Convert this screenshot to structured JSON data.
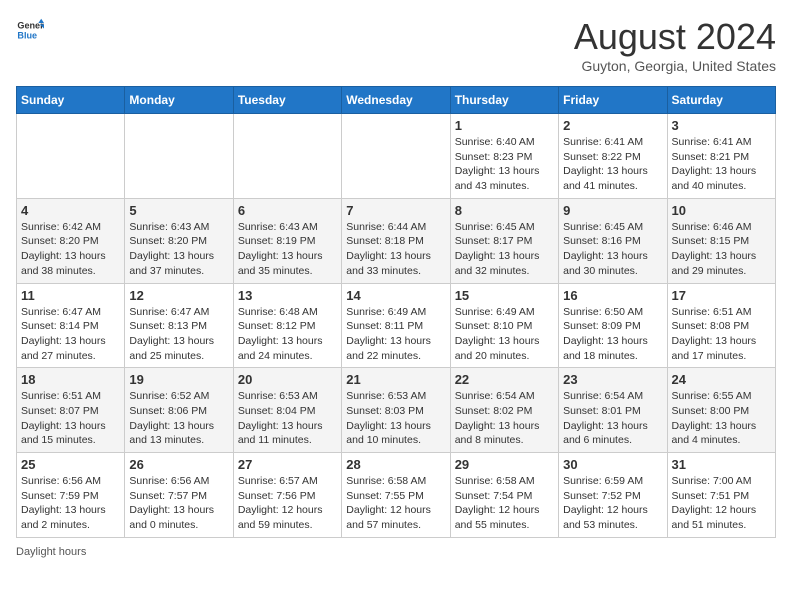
{
  "header": {
    "logo_general": "General",
    "logo_blue": "Blue",
    "month_title": "August 2024",
    "subtitle": "Guyton, Georgia, United States"
  },
  "days_of_week": [
    "Sunday",
    "Monday",
    "Tuesday",
    "Wednesday",
    "Thursday",
    "Friday",
    "Saturday"
  ],
  "weeks": [
    [
      {
        "day": "",
        "sunrise": "",
        "sunset": "",
        "daylight": ""
      },
      {
        "day": "",
        "sunrise": "",
        "sunset": "",
        "daylight": ""
      },
      {
        "day": "",
        "sunrise": "",
        "sunset": "",
        "daylight": ""
      },
      {
        "day": "",
        "sunrise": "",
        "sunset": "",
        "daylight": ""
      },
      {
        "day": "1",
        "sunrise": "Sunrise: 6:40 AM",
        "sunset": "Sunset: 8:23 PM",
        "daylight": "Daylight: 13 hours and 43 minutes."
      },
      {
        "day": "2",
        "sunrise": "Sunrise: 6:41 AM",
        "sunset": "Sunset: 8:22 PM",
        "daylight": "Daylight: 13 hours and 41 minutes."
      },
      {
        "day": "3",
        "sunrise": "Sunrise: 6:41 AM",
        "sunset": "Sunset: 8:21 PM",
        "daylight": "Daylight: 13 hours and 40 minutes."
      }
    ],
    [
      {
        "day": "4",
        "sunrise": "Sunrise: 6:42 AM",
        "sunset": "Sunset: 8:20 PM",
        "daylight": "Daylight: 13 hours and 38 minutes."
      },
      {
        "day": "5",
        "sunrise": "Sunrise: 6:43 AM",
        "sunset": "Sunset: 8:20 PM",
        "daylight": "Daylight: 13 hours and 37 minutes."
      },
      {
        "day": "6",
        "sunrise": "Sunrise: 6:43 AM",
        "sunset": "Sunset: 8:19 PM",
        "daylight": "Daylight: 13 hours and 35 minutes."
      },
      {
        "day": "7",
        "sunrise": "Sunrise: 6:44 AM",
        "sunset": "Sunset: 8:18 PM",
        "daylight": "Daylight: 13 hours and 33 minutes."
      },
      {
        "day": "8",
        "sunrise": "Sunrise: 6:45 AM",
        "sunset": "Sunset: 8:17 PM",
        "daylight": "Daylight: 13 hours and 32 minutes."
      },
      {
        "day": "9",
        "sunrise": "Sunrise: 6:45 AM",
        "sunset": "Sunset: 8:16 PM",
        "daylight": "Daylight: 13 hours and 30 minutes."
      },
      {
        "day": "10",
        "sunrise": "Sunrise: 6:46 AM",
        "sunset": "Sunset: 8:15 PM",
        "daylight": "Daylight: 13 hours and 29 minutes."
      }
    ],
    [
      {
        "day": "11",
        "sunrise": "Sunrise: 6:47 AM",
        "sunset": "Sunset: 8:14 PM",
        "daylight": "Daylight: 13 hours and 27 minutes."
      },
      {
        "day": "12",
        "sunrise": "Sunrise: 6:47 AM",
        "sunset": "Sunset: 8:13 PM",
        "daylight": "Daylight: 13 hours and 25 minutes."
      },
      {
        "day": "13",
        "sunrise": "Sunrise: 6:48 AM",
        "sunset": "Sunset: 8:12 PM",
        "daylight": "Daylight: 13 hours and 24 minutes."
      },
      {
        "day": "14",
        "sunrise": "Sunrise: 6:49 AM",
        "sunset": "Sunset: 8:11 PM",
        "daylight": "Daylight: 13 hours and 22 minutes."
      },
      {
        "day": "15",
        "sunrise": "Sunrise: 6:49 AM",
        "sunset": "Sunset: 8:10 PM",
        "daylight": "Daylight: 13 hours and 20 minutes."
      },
      {
        "day": "16",
        "sunrise": "Sunrise: 6:50 AM",
        "sunset": "Sunset: 8:09 PM",
        "daylight": "Daylight: 13 hours and 18 minutes."
      },
      {
        "day": "17",
        "sunrise": "Sunrise: 6:51 AM",
        "sunset": "Sunset: 8:08 PM",
        "daylight": "Daylight: 13 hours and 17 minutes."
      }
    ],
    [
      {
        "day": "18",
        "sunrise": "Sunrise: 6:51 AM",
        "sunset": "Sunset: 8:07 PM",
        "daylight": "Daylight: 13 hours and 15 minutes."
      },
      {
        "day": "19",
        "sunrise": "Sunrise: 6:52 AM",
        "sunset": "Sunset: 8:06 PM",
        "daylight": "Daylight: 13 hours and 13 minutes."
      },
      {
        "day": "20",
        "sunrise": "Sunrise: 6:53 AM",
        "sunset": "Sunset: 8:04 PM",
        "daylight": "Daylight: 13 hours and 11 minutes."
      },
      {
        "day": "21",
        "sunrise": "Sunrise: 6:53 AM",
        "sunset": "Sunset: 8:03 PM",
        "daylight": "Daylight: 13 hours and 10 minutes."
      },
      {
        "day": "22",
        "sunrise": "Sunrise: 6:54 AM",
        "sunset": "Sunset: 8:02 PM",
        "daylight": "Daylight: 13 hours and 8 minutes."
      },
      {
        "day": "23",
        "sunrise": "Sunrise: 6:54 AM",
        "sunset": "Sunset: 8:01 PM",
        "daylight": "Daylight: 13 hours and 6 minutes."
      },
      {
        "day": "24",
        "sunrise": "Sunrise: 6:55 AM",
        "sunset": "Sunset: 8:00 PM",
        "daylight": "Daylight: 13 hours and 4 minutes."
      }
    ],
    [
      {
        "day": "25",
        "sunrise": "Sunrise: 6:56 AM",
        "sunset": "Sunset: 7:59 PM",
        "daylight": "Daylight: 13 hours and 2 minutes."
      },
      {
        "day": "26",
        "sunrise": "Sunrise: 6:56 AM",
        "sunset": "Sunset: 7:57 PM",
        "daylight": "Daylight: 13 hours and 0 minutes."
      },
      {
        "day": "27",
        "sunrise": "Sunrise: 6:57 AM",
        "sunset": "Sunset: 7:56 PM",
        "daylight": "Daylight: 12 hours and 59 minutes."
      },
      {
        "day": "28",
        "sunrise": "Sunrise: 6:58 AM",
        "sunset": "Sunset: 7:55 PM",
        "daylight": "Daylight: 12 hours and 57 minutes."
      },
      {
        "day": "29",
        "sunrise": "Sunrise: 6:58 AM",
        "sunset": "Sunset: 7:54 PM",
        "daylight": "Daylight: 12 hours and 55 minutes."
      },
      {
        "day": "30",
        "sunrise": "Sunrise: 6:59 AM",
        "sunset": "Sunset: 7:52 PM",
        "daylight": "Daylight: 12 hours and 53 minutes."
      },
      {
        "day": "31",
        "sunrise": "Sunrise: 7:00 AM",
        "sunset": "Sunset: 7:51 PM",
        "daylight": "Daylight: 12 hours and 51 minutes."
      }
    ]
  ],
  "footer": {
    "daylight_label": "Daylight hours"
  }
}
